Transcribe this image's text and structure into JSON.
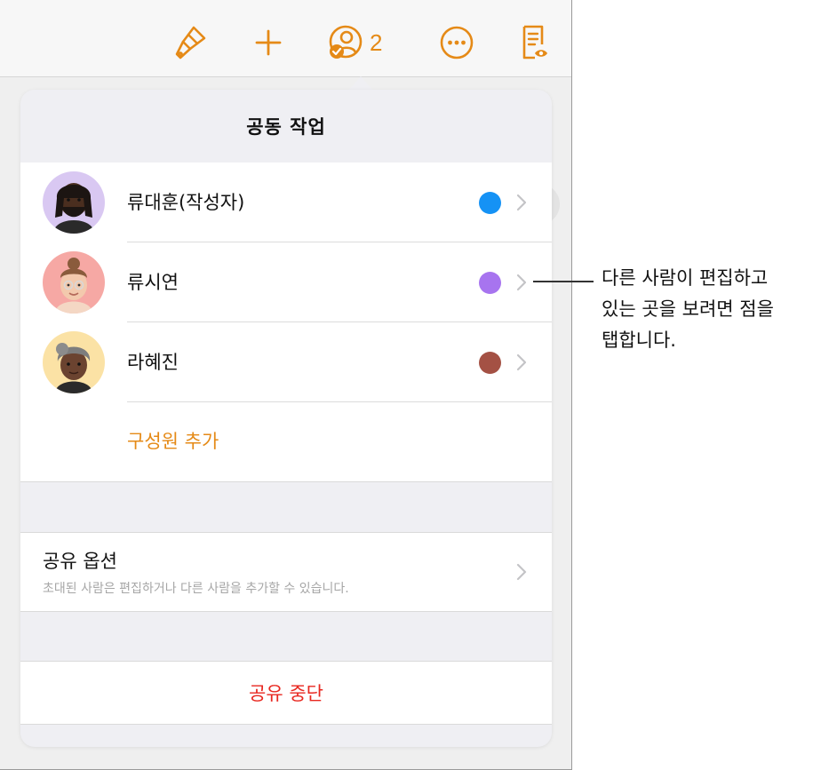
{
  "toolbar": {
    "items": [
      "paintbrush-icon",
      "plus-icon",
      "collaborate-icon",
      "more-icon",
      "reader-view-icon"
    ],
    "collaborator_count": "2",
    "accent_color": "#e58a17"
  },
  "popover": {
    "title": "공동 작업",
    "people": [
      {
        "name": "류대훈(작성자)",
        "color": "#1592f5",
        "avatar_bg": "#d9c8f2"
      },
      {
        "name": "류시연",
        "color": "#a774ef",
        "avatar_bg": "#f6a8a4"
      },
      {
        "name": "라혜진",
        "color": "#a45144",
        "avatar_bg": "#fbe2a5"
      }
    ],
    "add_member_label": "구성원 추가",
    "share_options": {
      "title": "공유 옵션",
      "subtitle": "초대된 사람은 편집하거나 다른 사람을 추가할 수 있습니다."
    },
    "stop_sharing_label": "공유 중단"
  },
  "callout": {
    "lines": [
      "다른 사람이 편집하고",
      "있는 곳을 보려면 점을",
      "탭합니다."
    ]
  }
}
